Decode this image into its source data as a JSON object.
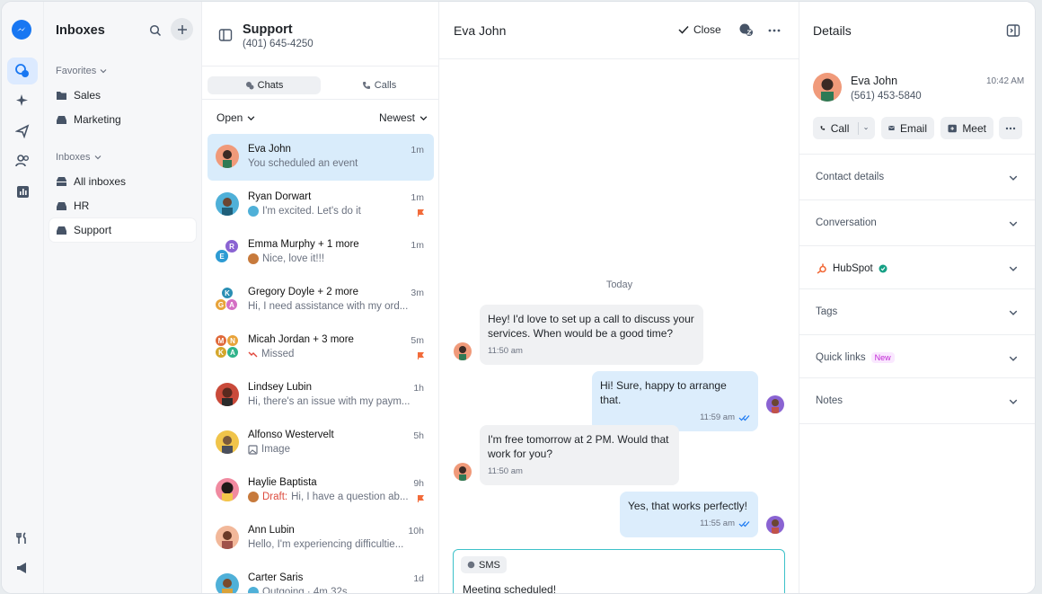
{
  "rail": {
    "items": [
      "inbox",
      "sparkle",
      "campaigns",
      "contacts",
      "reports"
    ],
    "bottom": [
      "tools",
      "announcements"
    ]
  },
  "sidebar": {
    "title": "Inboxes",
    "favorites_label": "Favorites",
    "favorites": [
      {
        "label": "Sales"
      },
      {
        "label": "Marketing"
      }
    ],
    "inboxes_label": "Inboxes",
    "inboxes": [
      {
        "label": "All inboxes"
      },
      {
        "label": "HR"
      },
      {
        "label": "Support"
      }
    ]
  },
  "inbox": {
    "name": "Support",
    "phone": "(401) 645-4250",
    "tabs": [
      {
        "label": "Chats"
      },
      {
        "label": "Calls"
      }
    ],
    "status_filter": "Open",
    "sort": "Newest"
  },
  "conversations": [
    {
      "name": "Eva John",
      "preview": "You scheduled an event",
      "time": "1m"
    },
    {
      "name": "Ryan Dorwart",
      "preview": "I'm excited. Let's do it",
      "time": "1m"
    },
    {
      "name": "Emma Murphy + 1 more",
      "preview": "Nice, love it!!!",
      "time": "1m"
    },
    {
      "name": "Gregory Doyle + 2 more",
      "preview": "Hi, I need assistance with my ord...",
      "time": "3m"
    },
    {
      "name": "Micah Jordan + 3 more",
      "preview": "Missed",
      "time": "5m"
    },
    {
      "name": "Lindsey Lubin",
      "preview": "Hi, there's an issue with my paym...",
      "time": "1h"
    },
    {
      "name": "Alfonso Westervelt",
      "preview": "Image",
      "time": "5h"
    },
    {
      "name": "Haylie Baptista",
      "draft": "Draft:",
      "preview": "Hi, I have a question ab...",
      "time": "9h"
    },
    {
      "name": "Ann Lubin",
      "preview": "Hello, I'm experiencing difficultie...",
      "time": "10h"
    },
    {
      "name": "Carter Saris",
      "preview": "Outgoing · 4m 32s",
      "time": "1d"
    }
  ],
  "group_initials": {
    "emma": [
      "R",
      "E"
    ],
    "gregory": [
      "K",
      "G",
      "A"
    ],
    "micah": [
      "M",
      "N",
      "K",
      "A"
    ]
  },
  "chat": {
    "title": "Eva John",
    "close_label": "Close",
    "day_label": "Today",
    "messages": [
      {
        "dir": "in",
        "text": "Hey! I'd love to set up a call to discuss your services. When would be a good time?",
        "time": "11:50 am"
      },
      {
        "dir": "out",
        "text": "Hi! Sure, happy to arrange that.",
        "time": "11:59 am"
      },
      {
        "dir": "in",
        "text": "I'm free tomorrow at 2 PM. Would that work for you?",
        "time": "11:50 am"
      },
      {
        "dir": "out",
        "text": "Yes, that works perfectly!",
        "time": "11:55 am"
      }
    ],
    "composer": {
      "channel": "SMS",
      "text": "Meeting scheduled!"
    }
  },
  "details": {
    "title": "Details",
    "contact": {
      "name": "Eva John",
      "phone": "(561) 453-5840",
      "time": "10:42 AM"
    },
    "actions": {
      "call": "Call",
      "email": "Email",
      "meet": "Meet"
    },
    "sections": [
      {
        "label": "Contact details"
      },
      {
        "label": "Conversation"
      },
      {
        "label": "HubSpot"
      },
      {
        "label": "Tags"
      },
      {
        "label": "Quick links",
        "badge": "New"
      },
      {
        "label": "Notes"
      }
    ]
  },
  "colors": {
    "accent": "#1877f2",
    "selected": "#d9ecfb",
    "outgoing": "#dcedfc",
    "composer_border": "#3cc1c9",
    "flag": "#f26b3a"
  }
}
